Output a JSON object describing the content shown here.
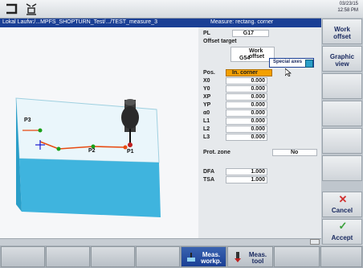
{
  "top_bar": {
    "date": "03/23/15",
    "time": "12:58 PM"
  },
  "title_bar": {
    "path": "Lokal Laufw:/...MPFS_SHOPTURN_Test/.../TEST_measure_3",
    "mode": "Measure: rectang. corner"
  },
  "params": {
    "pl_label": "PL",
    "pl_value": "G17",
    "offset_target_label": "Offset target",
    "work_offset_label": "Work offset",
    "work_offset_value": "G54",
    "special_axes_label": "Special axes",
    "pos_label": "Pos.",
    "pos_value": "In. corner",
    "rows": [
      {
        "label": "X0",
        "value": "0.000"
      },
      {
        "label": "Y0",
        "value": "0.000"
      },
      {
        "label": "XP",
        "value": "0.000"
      },
      {
        "label": "YP",
        "value": "0.000"
      },
      {
        "label": "α0",
        "value": "0.000"
      },
      {
        "label": "L1",
        "value": "0.000"
      },
      {
        "label": "L2",
        "value": "0.000"
      },
      {
        "label": "L3",
        "value": "0.000"
      }
    ],
    "prot_zone_label": "Prot. zone",
    "prot_zone_value": "No",
    "dfa_label": "DFA",
    "dfa_value": "1.000",
    "tsa_label": "TSA",
    "tsa_value": "1.000"
  },
  "graphic": {
    "p1": "P1",
    "p2": "P2",
    "p3": "P3"
  },
  "right_softkeys": {
    "work_offset": "Work offset",
    "graphic_view": "Graphic view",
    "cancel": "Cancel",
    "accept": "Accept"
  },
  "bottom_softkeys": {
    "meas_workp": "Meas. workp.",
    "meas_tool": "Meas. tool"
  },
  "colors": {
    "title_bar": "#1a3f95",
    "accept": "#3aa03a",
    "cancel": "#d03030",
    "highlight": "#f3a000"
  }
}
